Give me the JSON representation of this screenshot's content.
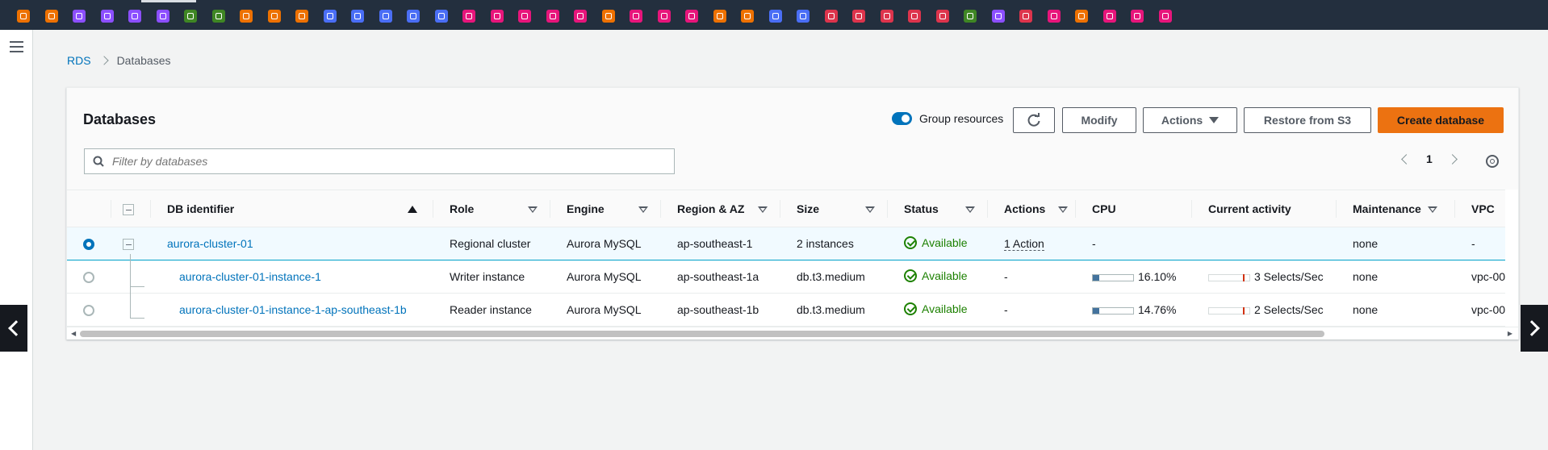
{
  "topbar": {
    "service_icons": [
      {
        "name": "service-icon-1",
        "color": "#ed7100"
      },
      {
        "name": "service-icon-2",
        "color": "#ed7100"
      },
      {
        "name": "service-icon-3",
        "color": "#8c4fff"
      },
      {
        "name": "service-icon-4",
        "color": "#8c4fff"
      },
      {
        "name": "service-icon-5",
        "color": "#8c4fff"
      },
      {
        "name": "service-icon-6",
        "color": "#8c4fff"
      },
      {
        "name": "service-icon-7",
        "color": "#3f8624"
      },
      {
        "name": "service-icon-8",
        "color": "#3f8624"
      },
      {
        "name": "service-icon-9",
        "color": "#ed7100"
      },
      {
        "name": "service-icon-10",
        "color": "#ed7100"
      },
      {
        "name": "service-icon-11",
        "color": "#ed7100"
      },
      {
        "name": "service-icon-12",
        "color": "#4a6ef5"
      },
      {
        "name": "service-icon-13",
        "color": "#4a6ef5"
      },
      {
        "name": "service-icon-14",
        "color": "#4a6ef5"
      },
      {
        "name": "service-icon-15",
        "color": "#4a6ef5"
      },
      {
        "name": "service-icon-16",
        "color": "#4a6ef5"
      },
      {
        "name": "service-icon-17",
        "color": "#e7157b"
      },
      {
        "name": "service-icon-18",
        "color": "#e7157b"
      },
      {
        "name": "service-icon-19",
        "color": "#e7157b"
      },
      {
        "name": "service-icon-20",
        "color": "#e7157b"
      },
      {
        "name": "service-icon-21",
        "color": "#e7157b"
      },
      {
        "name": "service-icon-22",
        "color": "#ed7100"
      },
      {
        "name": "service-icon-23",
        "color": "#e7157b"
      },
      {
        "name": "service-icon-24",
        "color": "#e7157b"
      },
      {
        "name": "service-icon-25",
        "color": "#e7157b"
      },
      {
        "name": "service-icon-26",
        "color": "#ed7100"
      },
      {
        "name": "service-icon-27",
        "color": "#ed7100"
      },
      {
        "name": "service-icon-28",
        "color": "#4a6ef5"
      },
      {
        "name": "service-icon-29",
        "color": "#4a6ef5"
      },
      {
        "name": "service-icon-30",
        "color": "#dd344c"
      },
      {
        "name": "service-icon-31",
        "color": "#dd344c"
      },
      {
        "name": "service-icon-32",
        "color": "#dd344c"
      },
      {
        "name": "service-icon-33",
        "color": "#dd344c"
      },
      {
        "name": "service-icon-34",
        "color": "#dd344c"
      },
      {
        "name": "service-icon-35",
        "color": "#3f8624"
      },
      {
        "name": "service-icon-36",
        "color": "#8c4fff"
      },
      {
        "name": "service-icon-37",
        "color": "#dd344c"
      },
      {
        "name": "service-icon-38",
        "color": "#e7157b"
      },
      {
        "name": "service-icon-39",
        "color": "#ed7100"
      },
      {
        "name": "service-icon-40",
        "color": "#e7157b"
      },
      {
        "name": "service-icon-41",
        "color": "#e7157b"
      },
      {
        "name": "service-icon-42",
        "color": "#e7157b"
      }
    ]
  },
  "breadcrumb": {
    "root": "RDS",
    "current": "Databases"
  },
  "panel": {
    "title": "Databases",
    "group_resources_label": "Group resources",
    "modify_label": "Modify",
    "actions_label": "Actions",
    "restore_label": "Restore from S3",
    "create_label": "Create database",
    "search_placeholder": "Filter by databases",
    "page_number": "1"
  },
  "columns": [
    "DB identifier",
    "Role",
    "Engine",
    "Region & AZ",
    "Size",
    "Status",
    "Actions",
    "CPU",
    "Current activity",
    "Maintenance",
    "VPC"
  ],
  "rows": [
    {
      "id": "aurora-cluster-01",
      "role": "Regional cluster",
      "engine": "Aurora MySQL",
      "region": "ap-southeast-1",
      "size": "2 instances",
      "status": "Available",
      "actions": "1 Action",
      "cpu": "-",
      "cpu_fill": 0,
      "activity": "",
      "maintenance": "none",
      "vpc": "-",
      "selected": true
    },
    {
      "id": "aurora-cluster-01-instance-1",
      "role": "Writer instance",
      "engine": "Aurora MySQL",
      "region": "ap-southeast-1a",
      "size": "db.t3.medium",
      "status": "Available",
      "actions": "-",
      "cpu": "16.10%",
      "cpu_fill": 0.161,
      "activity": "3 Selects/Sec",
      "maintenance": "none",
      "vpc": "vpc-00",
      "selected": false
    },
    {
      "id": "aurora-cluster-01-instance-1-ap-southeast-1b",
      "role": "Reader instance",
      "engine": "Aurora MySQL",
      "region": "ap-southeast-1b",
      "size": "db.t3.medium",
      "status": "Available",
      "actions": "-",
      "cpu": "14.76%",
      "cpu_fill": 0.1476,
      "activity": "2 Selects/Sec",
      "maintenance": "none",
      "vpc": "vpc-00",
      "selected": false
    }
  ]
}
